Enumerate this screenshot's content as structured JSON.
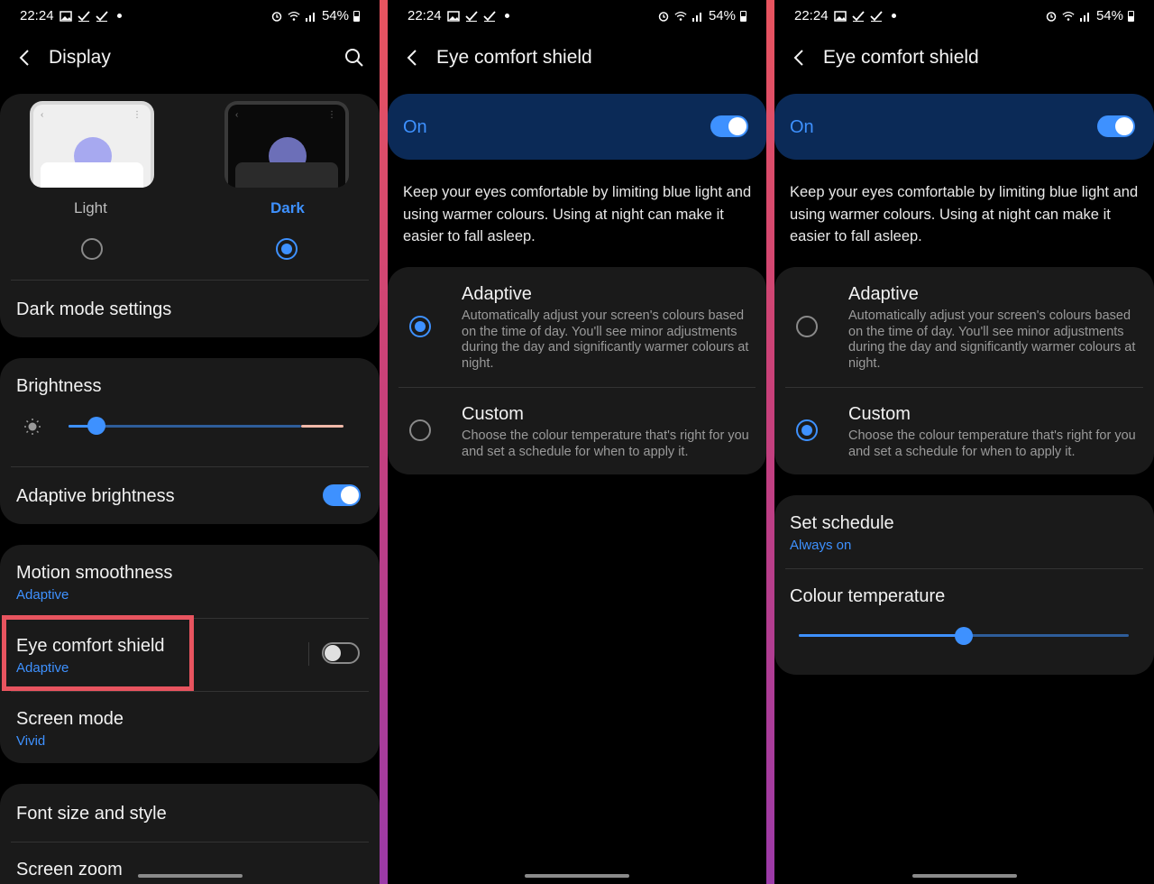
{
  "status": {
    "left": {
      "time": "22:24"
    },
    "center": {
      "time": "22:24"
    },
    "right": {
      "time": "22:24"
    },
    "battery": "54%"
  },
  "display_screen": {
    "title": "Display",
    "themes": [
      {
        "label": "Light",
        "selected": false
      },
      {
        "label": "Dark",
        "selected": true
      }
    ],
    "dark_mode_settings": "Dark mode settings",
    "brightness": {
      "label": "Brightness",
      "level": 0.1
    },
    "adaptive_brightness": {
      "label": "Adaptive brightness",
      "on": true
    },
    "motion_smoothness": {
      "label": "Motion smoothness",
      "value": "Adaptive"
    },
    "eye_comfort_shield": {
      "label": "Eye comfort shield",
      "value": "Adaptive",
      "on": false,
      "highlight_color": "#e8545f"
    },
    "screen_mode": {
      "label": "Screen mode",
      "value": "Vivid"
    },
    "font_size_style": "Font size and style",
    "screen_zoom": "Screen zoom"
  },
  "eye_screen_adaptive": {
    "title": "Eye comfort shield",
    "on_label": "On",
    "on": true,
    "description": "Keep your eyes comfortable by limiting blue light and using warmer colours. Using at night can make it easier to fall asleep.",
    "options": [
      {
        "label": "Adaptive",
        "desc": "Automatically adjust your screen's colours based on the time of day. You'll see minor adjustments during the day and significantly warmer colours at night.",
        "selected": true
      },
      {
        "label": "Custom",
        "desc": "Choose the colour temperature that's right for you and set a schedule for when to apply it.",
        "selected": false
      }
    ]
  },
  "eye_screen_custom": {
    "title": "Eye comfort shield",
    "on_label": "On",
    "on": true,
    "description": "Keep your eyes comfortable by limiting blue light and using warmer colours. Using at night can make it easier to fall asleep.",
    "options": [
      {
        "label": "Adaptive",
        "desc": "Automatically adjust your screen's colours based on the time of day. You'll see minor adjustments during the day and significantly warmer colours at night.",
        "selected": false
      },
      {
        "label": "Custom",
        "desc": "Choose the colour temperature that's right for you and set a schedule for when to apply it.",
        "selected": true
      }
    ],
    "set_schedule": {
      "label": "Set schedule",
      "value": "Always on"
    },
    "colour_temperature": {
      "label": "Colour temperature",
      "level": 0.5
    }
  },
  "colors": {
    "accent": "#3e91ff",
    "on_banner": "#0b2a57",
    "card": "#1a1a1a",
    "highlight": "#e8545f"
  }
}
